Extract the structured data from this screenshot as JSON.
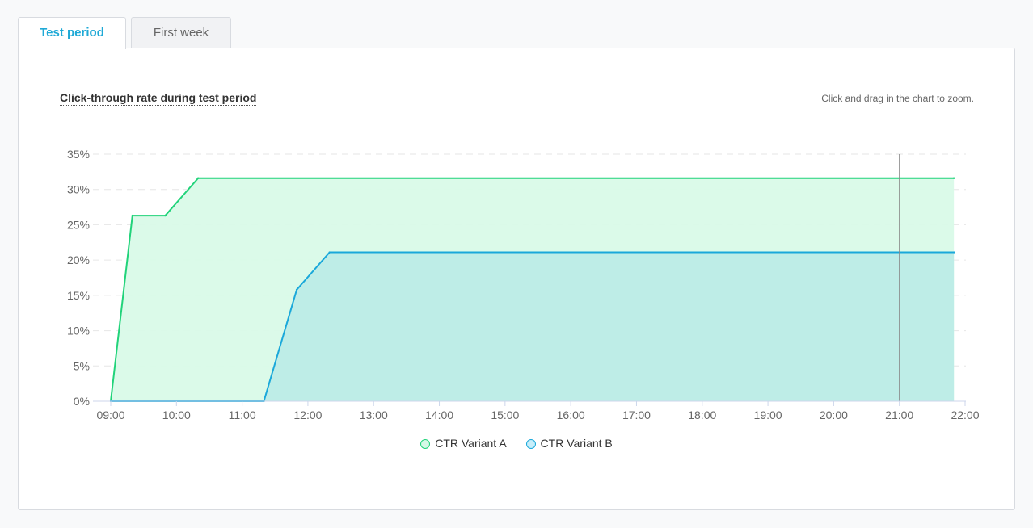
{
  "tabs": [
    {
      "label": "Test period",
      "active": true
    },
    {
      "label": "First week",
      "active": false
    }
  ],
  "zoom_hint": "Click and drag in the chart to zoom.",
  "colors": {
    "variant_a_line": "#21d37a",
    "variant_a_fill": "#d9fae8",
    "variant_b_line": "#1aa8da",
    "variant_b_fill": "#bdece7",
    "crosshair": "#888888",
    "grid": "#e6e6e6",
    "accent": "#1fa9d6"
  },
  "chart_data": {
    "type": "area",
    "title": "Click-through rate during test period",
    "xlabel": "",
    "ylabel": "",
    "x_ticks": [
      "09:00",
      "10:00",
      "11:00",
      "12:00",
      "13:00",
      "14:00",
      "15:00",
      "16:00",
      "17:00",
      "18:00",
      "19:00",
      "20:00",
      "21:00",
      "22:00"
    ],
    "y_ticks": [
      "0%",
      "5%",
      "10%",
      "15%",
      "20%",
      "25%",
      "30%",
      "35%"
    ],
    "xlim": [
      9.0,
      22.0
    ],
    "ylim": [
      0,
      35
    ],
    "grid": true,
    "legend_position": "bottom-center",
    "crosshair_x": 21.0,
    "series": [
      {
        "name": "CTR Variant A",
        "points": [
          [
            9.0,
            0
          ],
          [
            9.33,
            26.3
          ],
          [
            9.83,
            26.3
          ],
          [
            10.33,
            31.6
          ],
          [
            21.83,
            31.6
          ]
        ]
      },
      {
        "name": "CTR Variant B",
        "points": [
          [
            9.0,
            0
          ],
          [
            11.33,
            0
          ],
          [
            11.83,
            15.8
          ],
          [
            12.33,
            21.1
          ],
          [
            21.83,
            21.1
          ]
        ]
      }
    ]
  }
}
